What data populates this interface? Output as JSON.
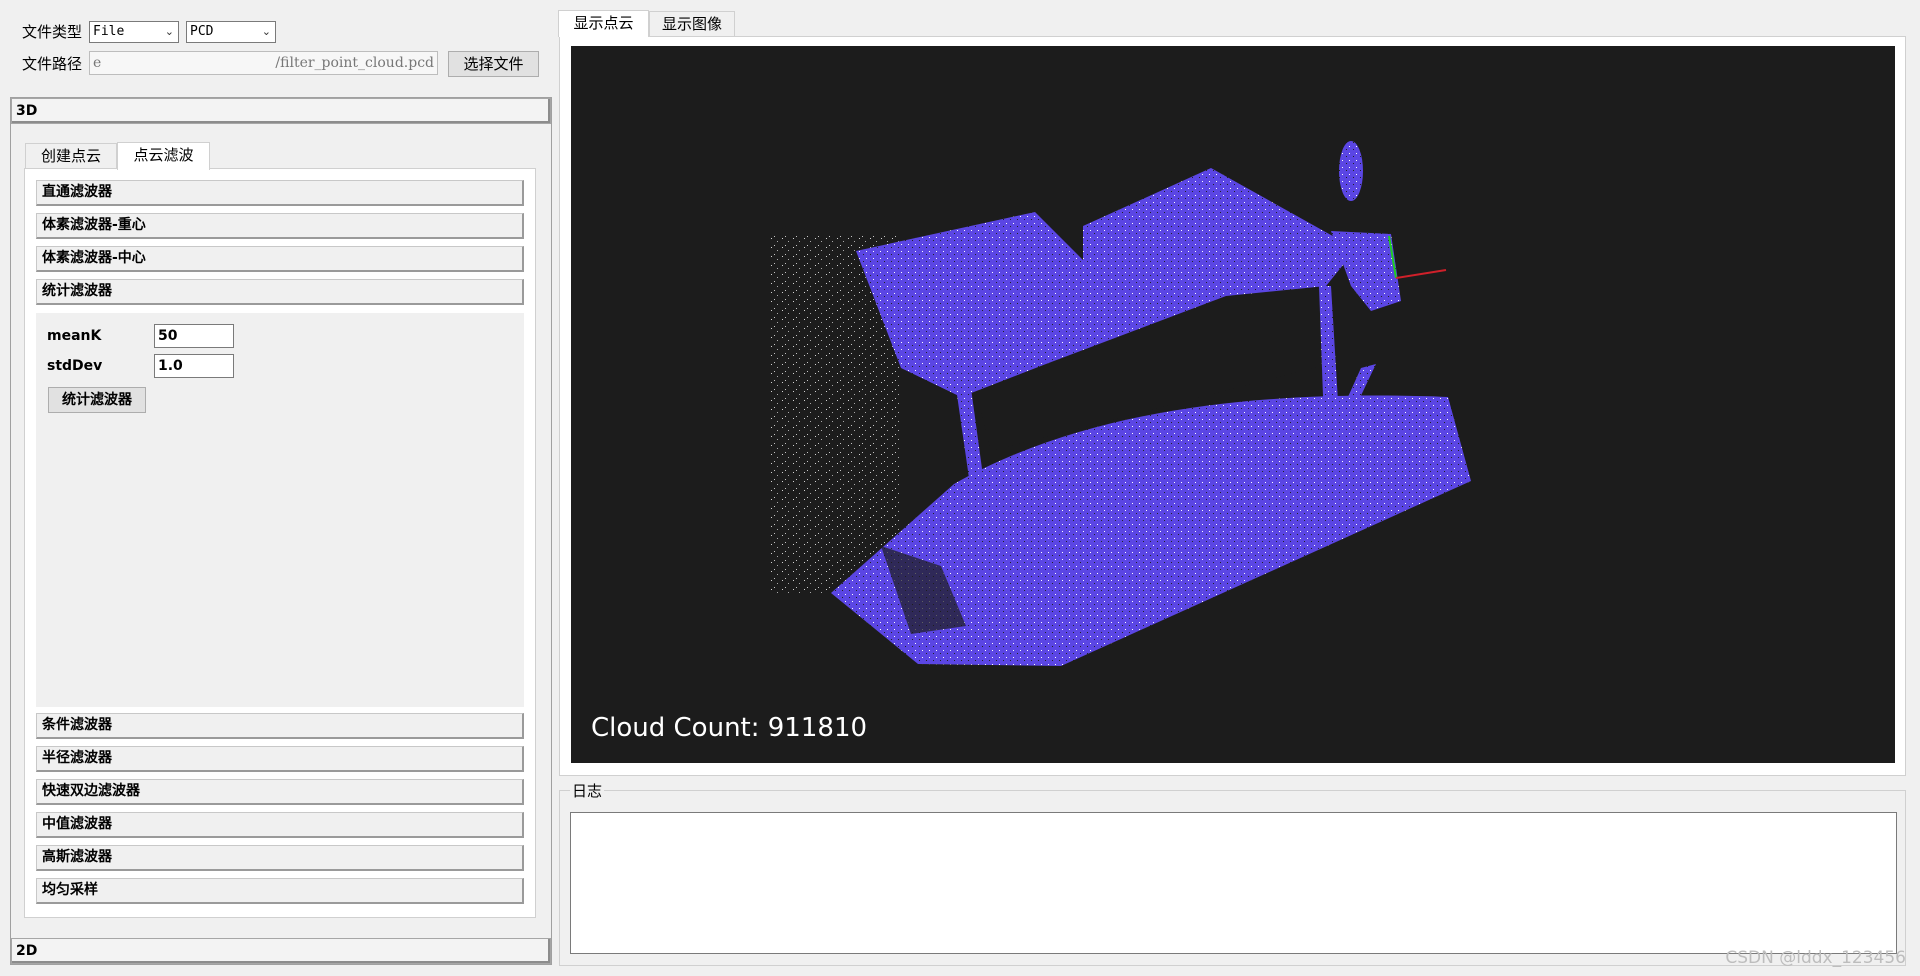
{
  "toolbar": {
    "file_type_label": "文件类型",
    "file_type_value": "File",
    "format_value": "PCD",
    "file_path_label": "文件路径",
    "file_path_prefix": "e",
    "file_path_suffix": "/filter_point_cloud.pcd",
    "choose_file_label": "选择文件"
  },
  "left_panel": {
    "group_3d_label": "3D",
    "group_2d_label": "2D",
    "tabs": [
      {
        "label": "创建点云",
        "active": false
      },
      {
        "label": "点云滤波",
        "active": true
      }
    ],
    "filters_top": [
      {
        "label": "直通滤波器"
      },
      {
        "label": "体素滤波器-重心"
      },
      {
        "label": "体素滤波器-中心"
      },
      {
        "label": "统计滤波器"
      }
    ],
    "statistical_filter": {
      "meanK_label": "meanK",
      "meanK_value": "50",
      "stdDev_label": "stdDev",
      "stdDev_value": "1.0",
      "apply_button_label": "统计滤波器"
    },
    "filters_bottom": [
      {
        "label": "条件滤波器"
      },
      {
        "label": "半径滤波器"
      },
      {
        "label": "快速双边滤波器"
      },
      {
        "label": "中值滤波器"
      },
      {
        "label": "高斯滤波器"
      },
      {
        "label": "均匀采样"
      }
    ]
  },
  "right_panel": {
    "tabs": [
      {
        "label": "显示点云",
        "active": true
      },
      {
        "label": "显示图像",
        "active": false
      }
    ],
    "viewer": {
      "cloud_count_text": "Cloud Count: 911810",
      "cloud_color": "#5b46e4",
      "background_color": "#1c1c1c"
    },
    "log_label": "日志",
    "log_text": ""
  },
  "watermark": "CSDN @lddx_123456"
}
